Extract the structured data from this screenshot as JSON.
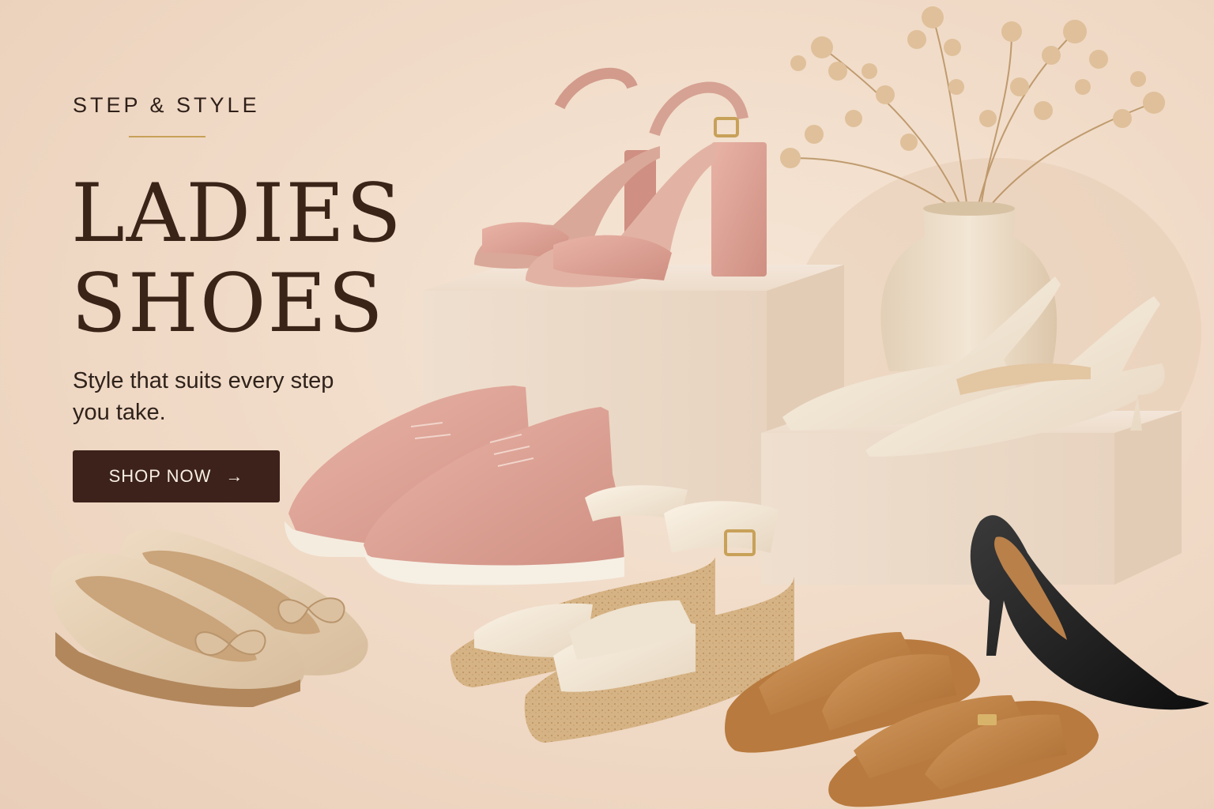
{
  "hero": {
    "eyebrow": "STEP & STYLE",
    "headline_line1": "LADIES",
    "headline_line2": "SHOES",
    "tagline": "Style that suits every step you take.",
    "cta_label": "SHOP NOW",
    "cta_arrow": "→"
  },
  "colors": {
    "background": "#f1ddcb",
    "text_dark": "#3a2418",
    "accent_gold": "#c8a159",
    "button_bg": "#3c221a",
    "button_text": "#f8eee4"
  },
  "products": [
    "blush-block-heel-sandals",
    "ivory-slingback-kitten-heels",
    "blush-knit-sneakers",
    "nude-bow-ballet-flats",
    "ivory-cork-wedge-sandals",
    "tan-crossover-slides",
    "black-pointed-pumps"
  ],
  "decor": [
    "ceramic-vase",
    "dried-flowers",
    "display-pedestals"
  ]
}
